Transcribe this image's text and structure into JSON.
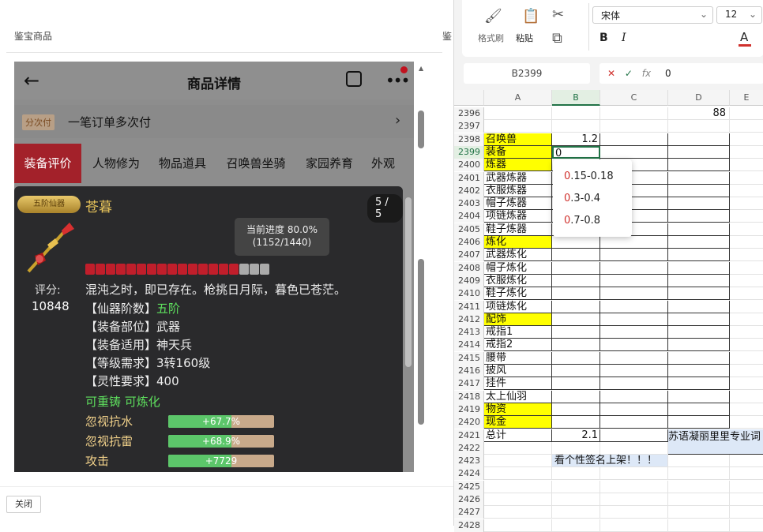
{
  "left_app": {
    "title": "鉴宝商品",
    "title_clipped": "鉴",
    "close_label": "关闭",
    "phone": {
      "header_title": "商品详情",
      "payment_tag": "分次付",
      "payment_text": "一笔订单多次付",
      "tabs": [
        "装备评价",
        "人物修为",
        "物品道具",
        "召唤兽坐骑",
        "家园养育",
        "外观"
      ],
      "active_tab": 0,
      "item": {
        "rank_badge": "五阶仙器",
        "name": "苍暮",
        "page_counter": "5 / 5",
        "tooltip_line1": "当前进度 80.0%",
        "tooltip_line2": "(1152/1440)",
        "progress": 0.8,
        "score_label": "评分:",
        "score_value": "10848",
        "desc": "混沌之时，即已存在。枪挑日月际，暮色已苍茫。",
        "attrs": [
          {
            "k": "【仙器阶数】",
            "v": "五阶",
            "green": true
          },
          {
            "k": "【装备部位】",
            "v": "武器",
            "green": false
          },
          {
            "k": "【装备适用】",
            "v": "神天兵",
            "green": false
          },
          {
            "k": "【等级需求】",
            "v": "3转160级",
            "green": false
          },
          {
            "k": "【灵性要求】",
            "v": "400",
            "green": false
          }
        ],
        "status": "可重铸 可炼化",
        "bonuses": [
          {
            "name": "忽视抗水",
            "value": "+67.7%",
            "fill": 0.6
          },
          {
            "name": "忽视抗雷",
            "value": "+68.9%",
            "fill": 0.6
          },
          {
            "name": "攻击",
            "value": "+7729",
            "fill": 0.6
          }
        ]
      }
    }
  },
  "spreadsheet": {
    "clipboard": {
      "format_painter": "格式刷",
      "paste": "粘贴"
    },
    "font_name": "宋体",
    "font_size": "12",
    "bold": "B",
    "italic": "I",
    "cell_ref": "B2399",
    "formula": "0",
    "fx": "fx",
    "columns": [
      "A",
      "B",
      "C",
      "D",
      "E"
    ],
    "rows": [
      {
        "n": "2396",
        "a": "",
        "b": "",
        "d": "88"
      },
      {
        "n": "2397",
        "a": "",
        "b": ""
      },
      {
        "n": "2398",
        "a": "召唤兽",
        "b": "1.2",
        "yel": true
      },
      {
        "n": "2399",
        "a": "装备",
        "b": "0",
        "yel": true,
        "sel": true
      },
      {
        "n": "2400",
        "a": "炼器",
        "b": "",
        "yel": true
      },
      {
        "n": "2401",
        "a": "武器炼器",
        "b": ""
      },
      {
        "n": "2402",
        "a": "衣服炼器",
        "b": ""
      },
      {
        "n": "2403",
        "a": "帽子炼器",
        "b": ""
      },
      {
        "n": "2404",
        "a": "项链炼器",
        "b": ""
      },
      {
        "n": "2405",
        "a": "鞋子炼器",
        "b": ""
      },
      {
        "n": "2406",
        "a": "炼化",
        "b": "",
        "yel": true
      },
      {
        "n": "2407",
        "a": "武器炼化",
        "b": ""
      },
      {
        "n": "2408",
        "a": "帽子炼化",
        "b": ""
      },
      {
        "n": "2409",
        "a": "衣服炼化",
        "b": ""
      },
      {
        "n": "2410",
        "a": "鞋子炼化",
        "b": ""
      },
      {
        "n": "2411",
        "a": "项链炼化",
        "b": ""
      },
      {
        "n": "2412",
        "a": "配饰",
        "b": "",
        "yel": true
      },
      {
        "n": "2413",
        "a": "戒指1",
        "b": ""
      },
      {
        "n": "2414",
        "a": "戒指2",
        "b": ""
      },
      {
        "n": "2415",
        "a": "腰带",
        "b": ""
      },
      {
        "n": "2416",
        "a": "披风",
        "b": ""
      },
      {
        "n": "2417",
        "a": "挂件",
        "b": ""
      },
      {
        "n": "2418",
        "a": "太上仙羽",
        "b": ""
      },
      {
        "n": "2419",
        "a": "物资",
        "b": "",
        "yel": true
      },
      {
        "n": "2420",
        "a": "现金",
        "b": "",
        "yel": true
      },
      {
        "n": "2421",
        "a": "总计",
        "b": "2.1",
        "d": "苏语凝丽里里专业词"
      },
      {
        "n": "2422",
        "a": "",
        "b": ""
      },
      {
        "n": "2423",
        "a": "",
        "b": "看个性签名上架！！！"
      },
      {
        "n": "2424",
        "a": "",
        "b": ""
      },
      {
        "n": "2425",
        "a": "",
        "b": ""
      },
      {
        "n": "2426",
        "a": "",
        "b": ""
      },
      {
        "n": "2427",
        "a": "",
        "b": ""
      },
      {
        "n": "2428",
        "a": "",
        "b": ""
      }
    ],
    "popup": [
      {
        "r": "0",
        "t": ".15-0.18"
      },
      {
        "r": "0",
        "t": ".3-0.4"
      },
      {
        "r": "0",
        "t": ".7-0.8"
      }
    ],
    "colors": {
      "highlight": "#ffff00",
      "selected": "#217346",
      "popup_accent": "#d0312d"
    }
  }
}
